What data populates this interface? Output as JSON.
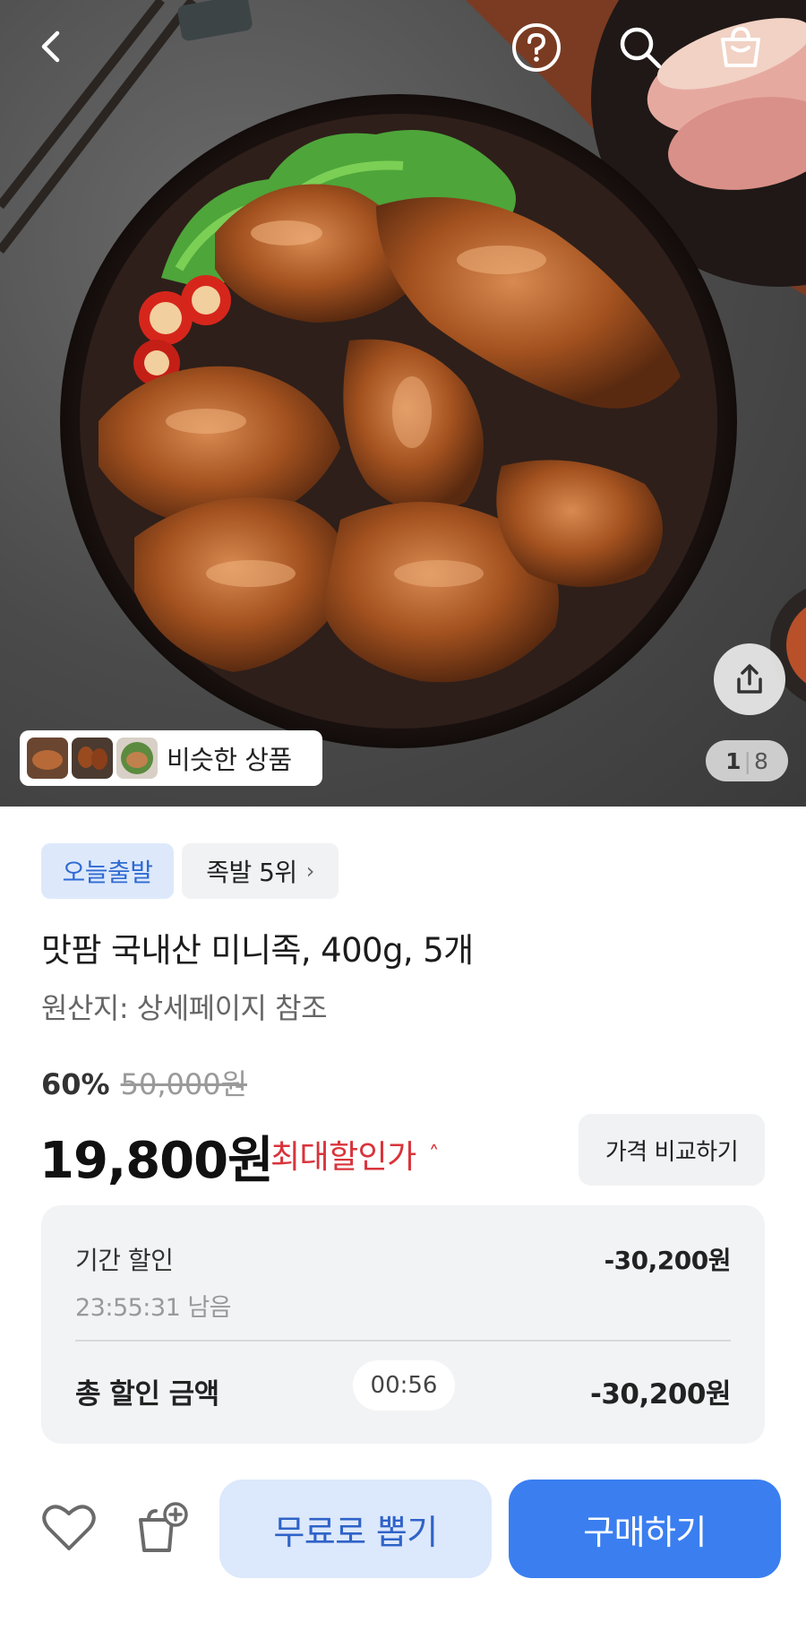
{
  "header": {
    "icons": [
      "chevron-left-icon",
      "help-circle-icon",
      "search-icon",
      "shopping-bag-icon"
    ]
  },
  "gallery": {
    "similar_label": "비슷한 상품",
    "current_page": "1",
    "separator": "|",
    "total_pages": "8"
  },
  "badges": {
    "today_shipping": "오늘출발",
    "rank": "족발 5위",
    "rank_chevron": "›"
  },
  "product": {
    "title": "맛팜 국내산 미니족, 400g, 5개",
    "origin": "원산지: 상세페이지 참조"
  },
  "price": {
    "discount_rate": "60%",
    "original": "50,000원",
    "final": "19,800원",
    "max_discount_label": "최대할인가",
    "max_discount_chevron": "˄",
    "compare_button": "가격 비교하기"
  },
  "discount_box": {
    "period_label": "기간 할인",
    "period_amount": "-30,200원",
    "remaining": "23:55:31 남음",
    "total_label": "총 할인 금액",
    "timer": "00:56",
    "total_amount": "-30,200원"
  },
  "bottom_bar": {
    "free_draw_button": "무료로 뽑기",
    "buy_button": "구매하기"
  },
  "colors": {
    "accent_blue": "#3a7ef0",
    "light_blue": "#dce8fb",
    "discount_red": "#d9333a"
  }
}
